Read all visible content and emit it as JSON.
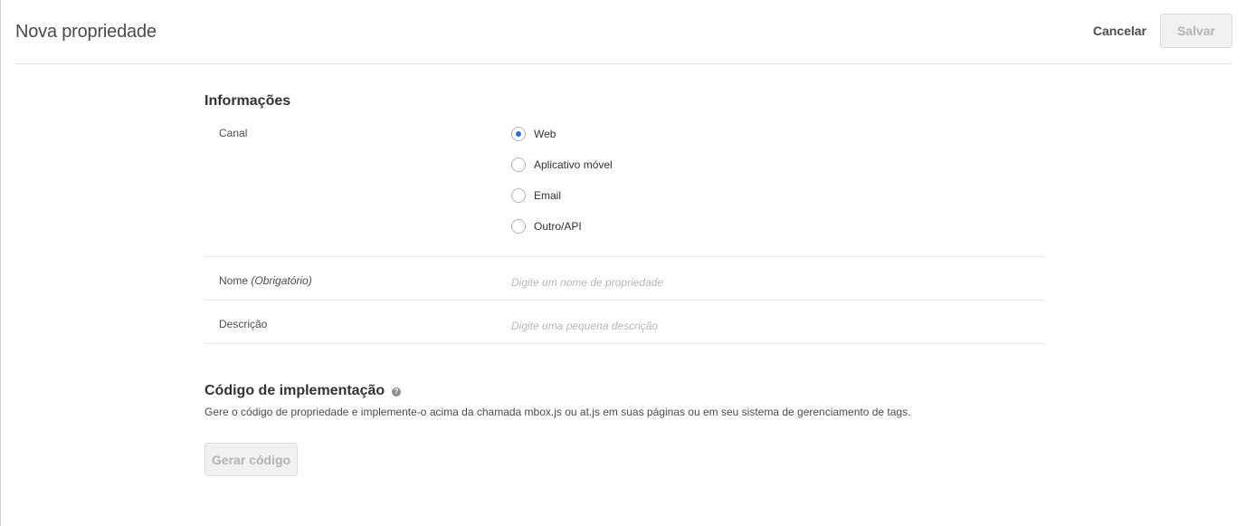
{
  "header": {
    "title": "Nova propriedade",
    "cancel_label": "Cancelar",
    "save_label": "Salvar"
  },
  "info_section": {
    "title": "Informações",
    "channel_label": "Canal",
    "channel_options": [
      {
        "label": "Web",
        "checked": true
      },
      {
        "label": "Aplicativo móvel",
        "checked": false
      },
      {
        "label": "Email",
        "checked": false
      },
      {
        "label": "Outro/API",
        "checked": false
      }
    ],
    "name_label": "Nome",
    "name_required": "(Obrigatório)",
    "name_value": "",
    "name_placeholder": "Digite um nome de propriedade",
    "description_label": "Descrição",
    "description_value": "",
    "description_placeholder": "Digite uma pequena descrição"
  },
  "code_section": {
    "title": "Código de implementação",
    "help_icon": "question-circle-icon",
    "help_glyph": "?",
    "description": "Gere o código de propriedade e implemente-o acima da chamada mbox.js ou at.js em suas páginas ou em seu sistema de gerenciamento de tags.",
    "generate_label": "Gerar código"
  },
  "colors": {
    "accent": "#2d6fc6",
    "disabled_button_bg": "#f1f1f1",
    "disabled_button_text": "#b3b3b3"
  }
}
